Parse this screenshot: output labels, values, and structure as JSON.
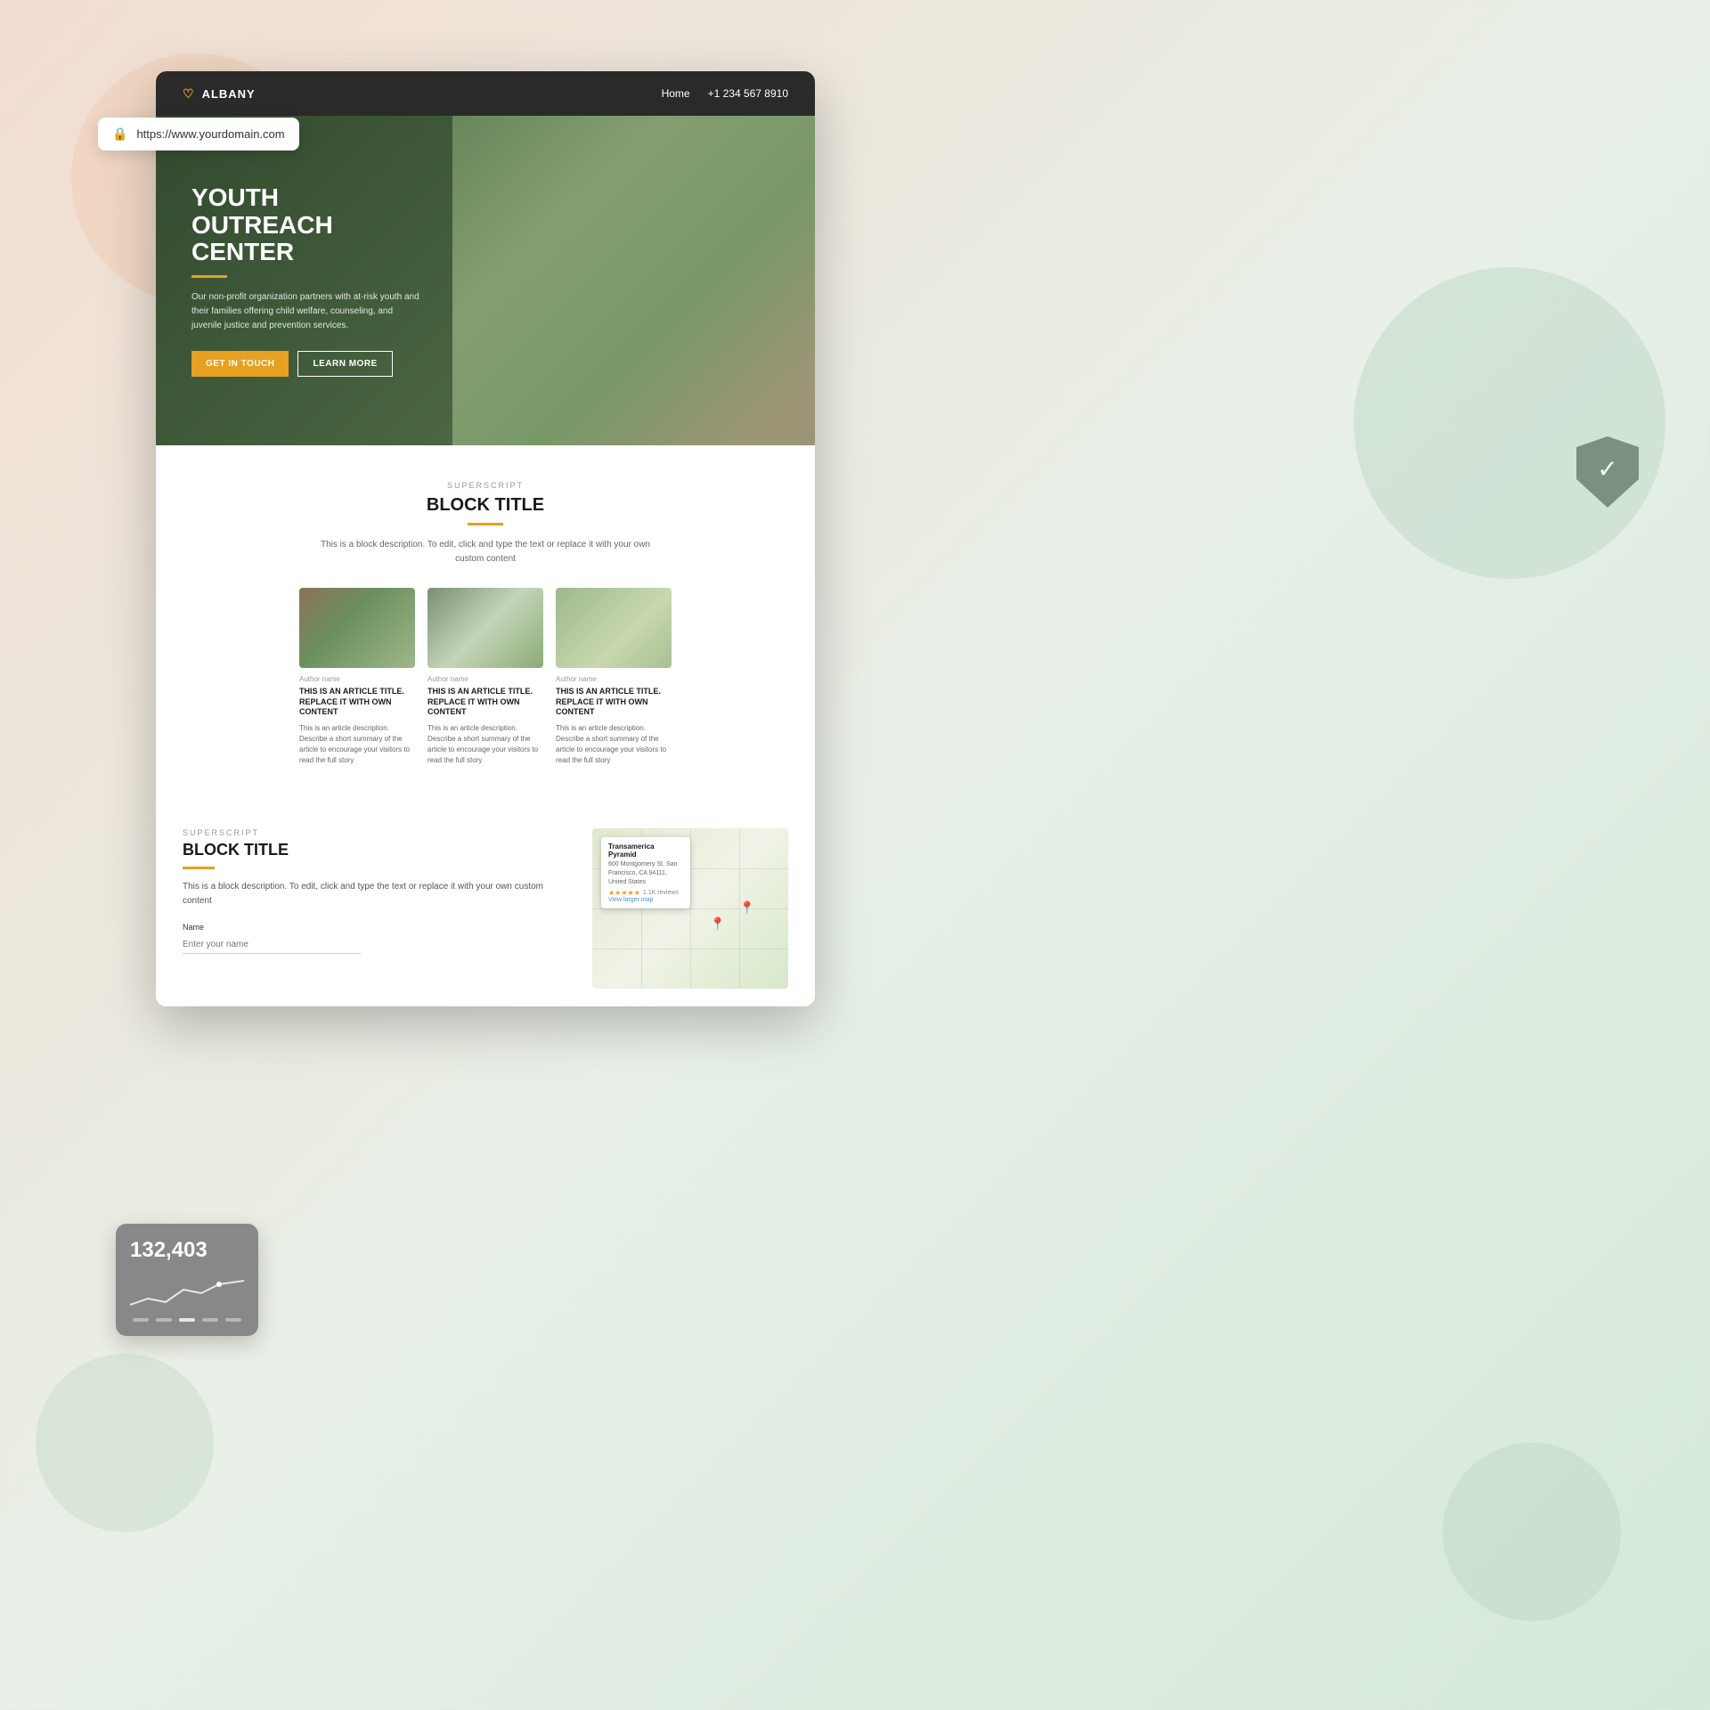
{
  "page": {
    "background": "gradient peach to sage green"
  },
  "url_bar": {
    "url": "https://www.yourdomain.com",
    "lock_icon": "🔒"
  },
  "navbar": {
    "logo_icon": "♡",
    "logo_text": "ALBANY",
    "nav_links": [
      "Home"
    ],
    "phone": "+1 234 567 8910"
  },
  "hero": {
    "title": "YOUTH OUTREACH CENTER",
    "description": "Our non-profit organization partners with at-risk youth and their families offering child welfare, counseling, and juvenile justice and prevention services.",
    "btn_primary": "GET IN TOUCH",
    "btn_secondary": "LEARN MORE"
  },
  "block_section": {
    "superscript": "SUPERSCRIPT",
    "title": "BLOCK TITLE",
    "description": "This is a block description. To edit, click and type the text or replace it with your own custom content",
    "articles": [
      {
        "author": "Author name",
        "title": "THIS IS AN ARTICLE TITLE. REPLACE IT WITH OWN CONTENT",
        "description": "This is an article description. Describe a short summary of the article to encourage your visitors to read the full story"
      },
      {
        "author": "Author name",
        "title": "THIS IS AN ARTICLE TITLE. REPLACE IT WITH OWN CONTENT",
        "description": "This is an article description. Describe a short summary of the article to encourage your visitors to read the full story"
      },
      {
        "author": "Author name",
        "title": "THIS IS AN ARTICLE TITLE. REPLACE IT WITH OWN CONTENT",
        "description": "This is an article description. Describe a short summary of the article to encourage your visitors to read the full story"
      }
    ]
  },
  "bottom_section": {
    "superscript": "SUPERSCRIPT",
    "title": "BLOCK TITLE",
    "description": "This is a block description. To edit, click and type the text or replace it with your own custom content",
    "form": {
      "name_label": "Name",
      "name_placeholder": "Enter your name"
    },
    "map": {
      "business_name": "Transamerica Pyramid",
      "address": "600 Montgomery St, San Francisco, CA 94111, United States",
      "rating": "4.6",
      "reviews": "1.1K reviews",
      "view_link": "View larger map"
    }
  },
  "stats_card": {
    "number": "132,403"
  },
  "security_badge": {
    "icon": "✓"
  }
}
